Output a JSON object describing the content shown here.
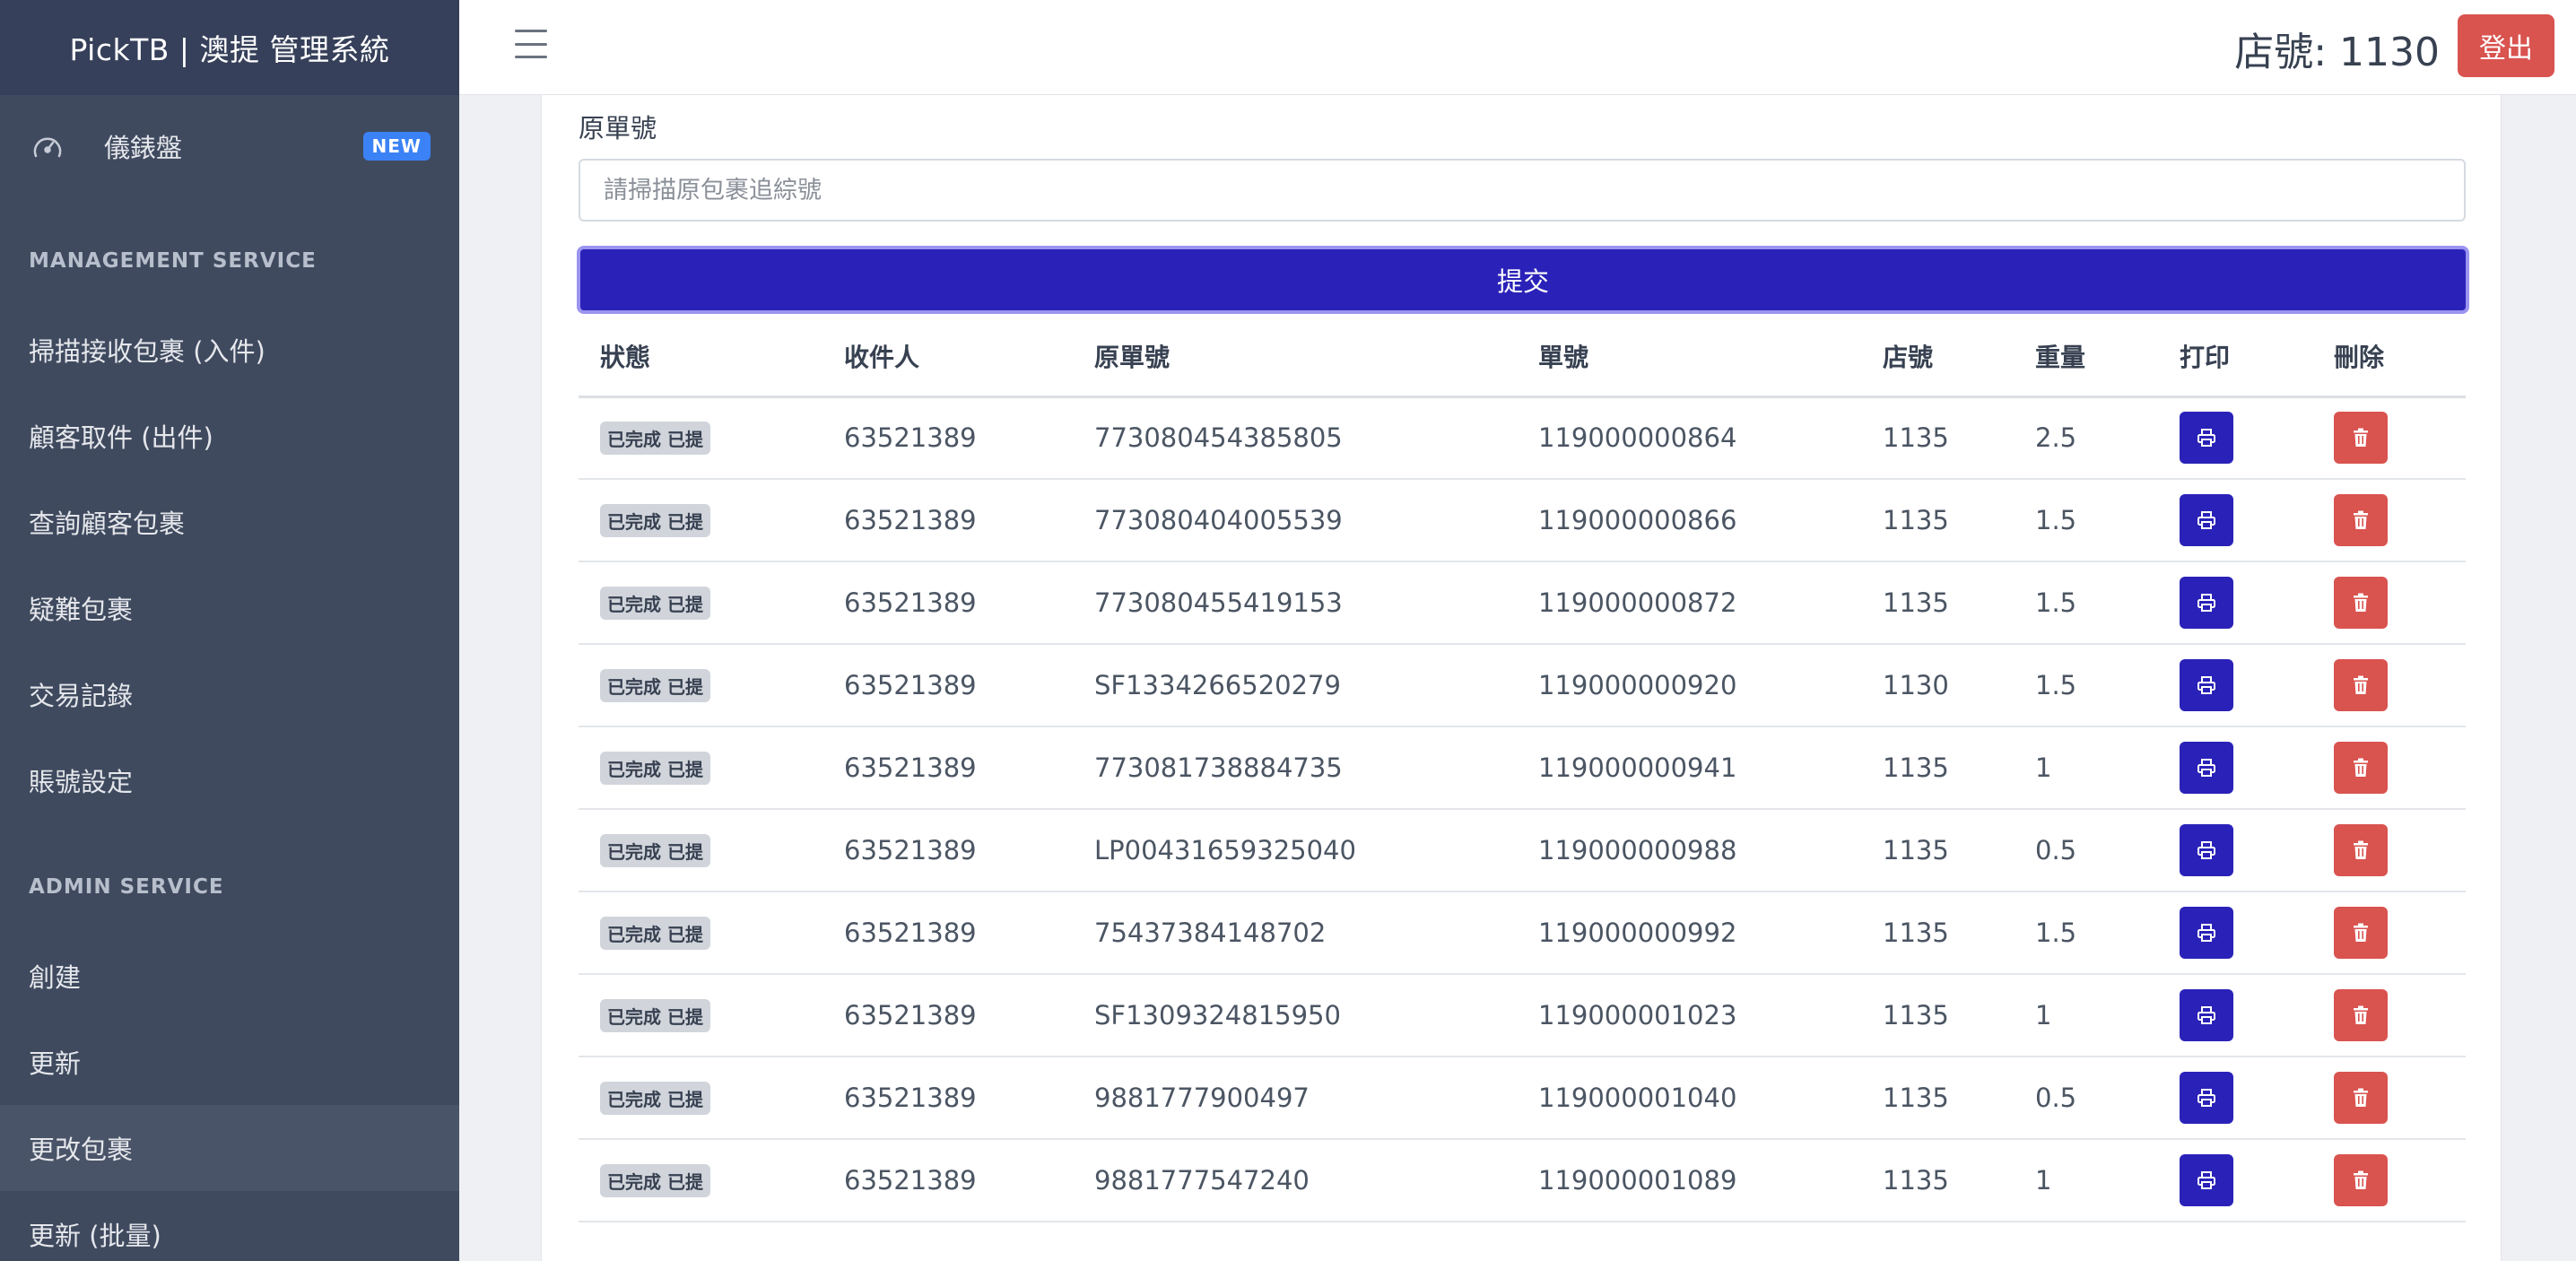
{
  "sidebar": {
    "brand": "PickTB | 澳提 管理系統",
    "dashboard": {
      "label": "儀錶盤",
      "badge": "NEW",
      "icon": "speedometer-icon"
    },
    "sections": [
      {
        "title": "MANAGEMENT SERVICE",
        "items": [
          "掃描接收包裹 (入件)",
          "顧客取件 (出件)",
          "查詢顧客包裹",
          "疑難包裹",
          "交易記錄",
          "賬號設定"
        ]
      },
      {
        "title": "ADMIN SERVICE",
        "items": [
          "創建",
          "更新",
          "更改包裹",
          "更新 (批量)"
        ],
        "active": "更改包裹"
      }
    ]
  },
  "header": {
    "menu_icon": "hamburger-menu-icon",
    "store_label": "店號: 1130",
    "logout_label": "登出"
  },
  "form": {
    "label": "原單號",
    "placeholder": "請掃描原包裹追綜號",
    "submit_label": "提交"
  },
  "table": {
    "headers": [
      "狀態",
      "收件人",
      "原單號",
      "單號",
      "店號",
      "重量",
      "打印",
      "刪除"
    ],
    "rows": [
      {
        "status": "已完成 已提",
        "recipient": "63521389",
        "original_no": "773080454385805",
        "order_no": "119000000864",
        "store": "1135",
        "weight": "2.5"
      },
      {
        "status": "已完成 已提",
        "recipient": "63521389",
        "original_no": "773080404005539",
        "order_no": "119000000866",
        "store": "1135",
        "weight": "1.5"
      },
      {
        "status": "已完成 已提",
        "recipient": "63521389",
        "original_no": "773080455419153",
        "order_no": "119000000872",
        "store": "1135",
        "weight": "1.5"
      },
      {
        "status": "已完成 已提",
        "recipient": "63521389",
        "original_no": "SF1334266520279",
        "order_no": "119000000920",
        "store": "1130",
        "weight": "1.5"
      },
      {
        "status": "已完成 已提",
        "recipient": "63521389",
        "original_no": "773081738884735",
        "order_no": "119000000941",
        "store": "1135",
        "weight": "1"
      },
      {
        "status": "已完成 已提",
        "recipient": "63521389",
        "original_no": "LP00431659325040",
        "order_no": "119000000988",
        "store": "1135",
        "weight": "0.5"
      },
      {
        "status": "已完成 已提",
        "recipient": "63521389",
        "original_no": "75437384148702",
        "order_no": "119000000992",
        "store": "1135",
        "weight": "1.5"
      },
      {
        "status": "已完成 已提",
        "recipient": "63521389",
        "original_no": "SF1309324815950",
        "order_no": "119000001023",
        "store": "1135",
        "weight": "1"
      },
      {
        "status": "已完成 已提",
        "recipient": "63521389",
        "original_no": "9881777900497",
        "order_no": "119000001040",
        "store": "1135",
        "weight": "0.5"
      },
      {
        "status": "已完成 已提",
        "recipient": "63521389",
        "original_no": "9881777547240",
        "order_no": "119000001089",
        "store": "1135",
        "weight": "1"
      }
    ],
    "print_icon": "printer-icon",
    "delete_icon": "trash-icon"
  },
  "colors": {
    "sidebar_bg": "#3f4a5f",
    "primary": "#2a22b8",
    "danger": "#d9534f",
    "badge_new": "#3b82f6"
  }
}
